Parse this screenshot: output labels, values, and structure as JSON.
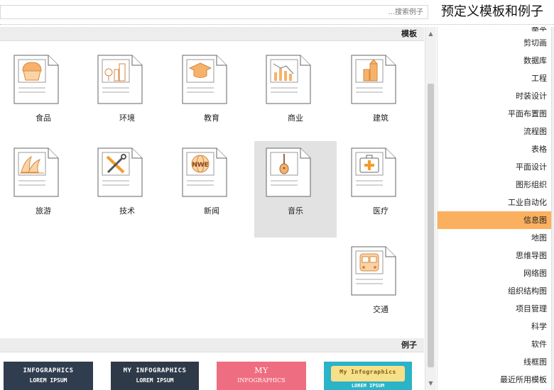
{
  "header": {
    "title": "预定义模板和例子",
    "search_placeholder": "搜索例子..."
  },
  "sidebar": {
    "items": [
      {
        "label": "基本"
      },
      {
        "label": "剪切画"
      },
      {
        "label": "数据库"
      },
      {
        "label": "工程"
      },
      {
        "label": "时装设计"
      },
      {
        "label": "平面布置图"
      },
      {
        "label": "流程图"
      },
      {
        "label": "表格"
      },
      {
        "label": "平面设计"
      },
      {
        "label": "图形组织"
      },
      {
        "label": "工业自动化"
      },
      {
        "label": "信息图",
        "active": true
      },
      {
        "label": "地图"
      },
      {
        "label": "思维导图"
      },
      {
        "label": "网络图"
      },
      {
        "label": "组织结构图"
      },
      {
        "label": "项目管理"
      },
      {
        "label": "科学"
      },
      {
        "label": "软件"
      },
      {
        "label": "线框图"
      },
      {
        "label": "最近所用模板"
      }
    ]
  },
  "templates": {
    "header": "模板",
    "items": [
      {
        "label": "建筑",
        "icon": "building-icon"
      },
      {
        "label": "商业",
        "icon": "bar-chart-icon"
      },
      {
        "label": "教育",
        "icon": "graduation-cap-icon"
      },
      {
        "label": "环境",
        "icon": "tree-city-icon"
      },
      {
        "label": "食品",
        "icon": "cupcake-icon"
      },
      {
        "label": "医疗",
        "icon": "first-aid-kit-icon"
      },
      {
        "label": "音乐",
        "icon": "guitar-icon",
        "selected": true
      },
      {
        "label": "新闻",
        "icon": "globe-news-icon"
      },
      {
        "label": "技术",
        "icon": "tools-icon"
      },
      {
        "label": "旅游",
        "icon": "opera-house-icon"
      },
      {
        "label": "交通",
        "icon": "bus-icon"
      }
    ]
  },
  "examples": {
    "header": "例子",
    "items": [
      {
        "line1": "My Infographics",
        "line2": "LOREM IPSUM",
        "color": "#2bb3c8"
      },
      {
        "line1": "MY",
        "line2": "INFOGRAPHICS",
        "color": "#ef6d80"
      },
      {
        "line1": "MY INFOGRAPHICS",
        "line2": "LOREM IPSUM",
        "color": "#2e3a48"
      },
      {
        "line1": "INFOGRAPHICS",
        "line2": "LOREM IPSUM",
        "color": "#2f3d4f"
      }
    ]
  },
  "colors": {
    "accent": "#fbb05f",
    "icon_orange": "#f5a34a",
    "selected_bg": "#e2e2e2"
  }
}
